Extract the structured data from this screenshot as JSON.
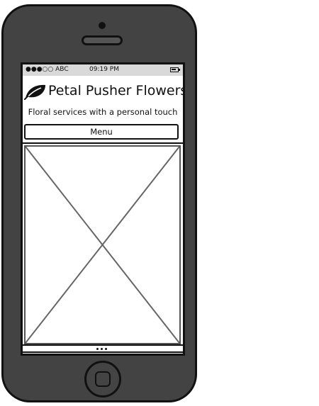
{
  "status_bar": {
    "signal": "●●●○○",
    "carrier": "ABC",
    "time": "09:19 PM"
  },
  "header": {
    "brand_name": "Petal Pusher Flowers",
    "logo_icon": "leaf-icon",
    "tagline": "Floral services with a personal touch"
  },
  "nav": {
    "menu_label": "Menu"
  },
  "content": {
    "image_placeholder": "image-placeholder-icon",
    "page_count": 3
  },
  "colors": {
    "phone_body": "#434343",
    "screen_bg": "#ffffff",
    "status_bar_bg": "#d9d9d9",
    "outline": "#111111"
  }
}
